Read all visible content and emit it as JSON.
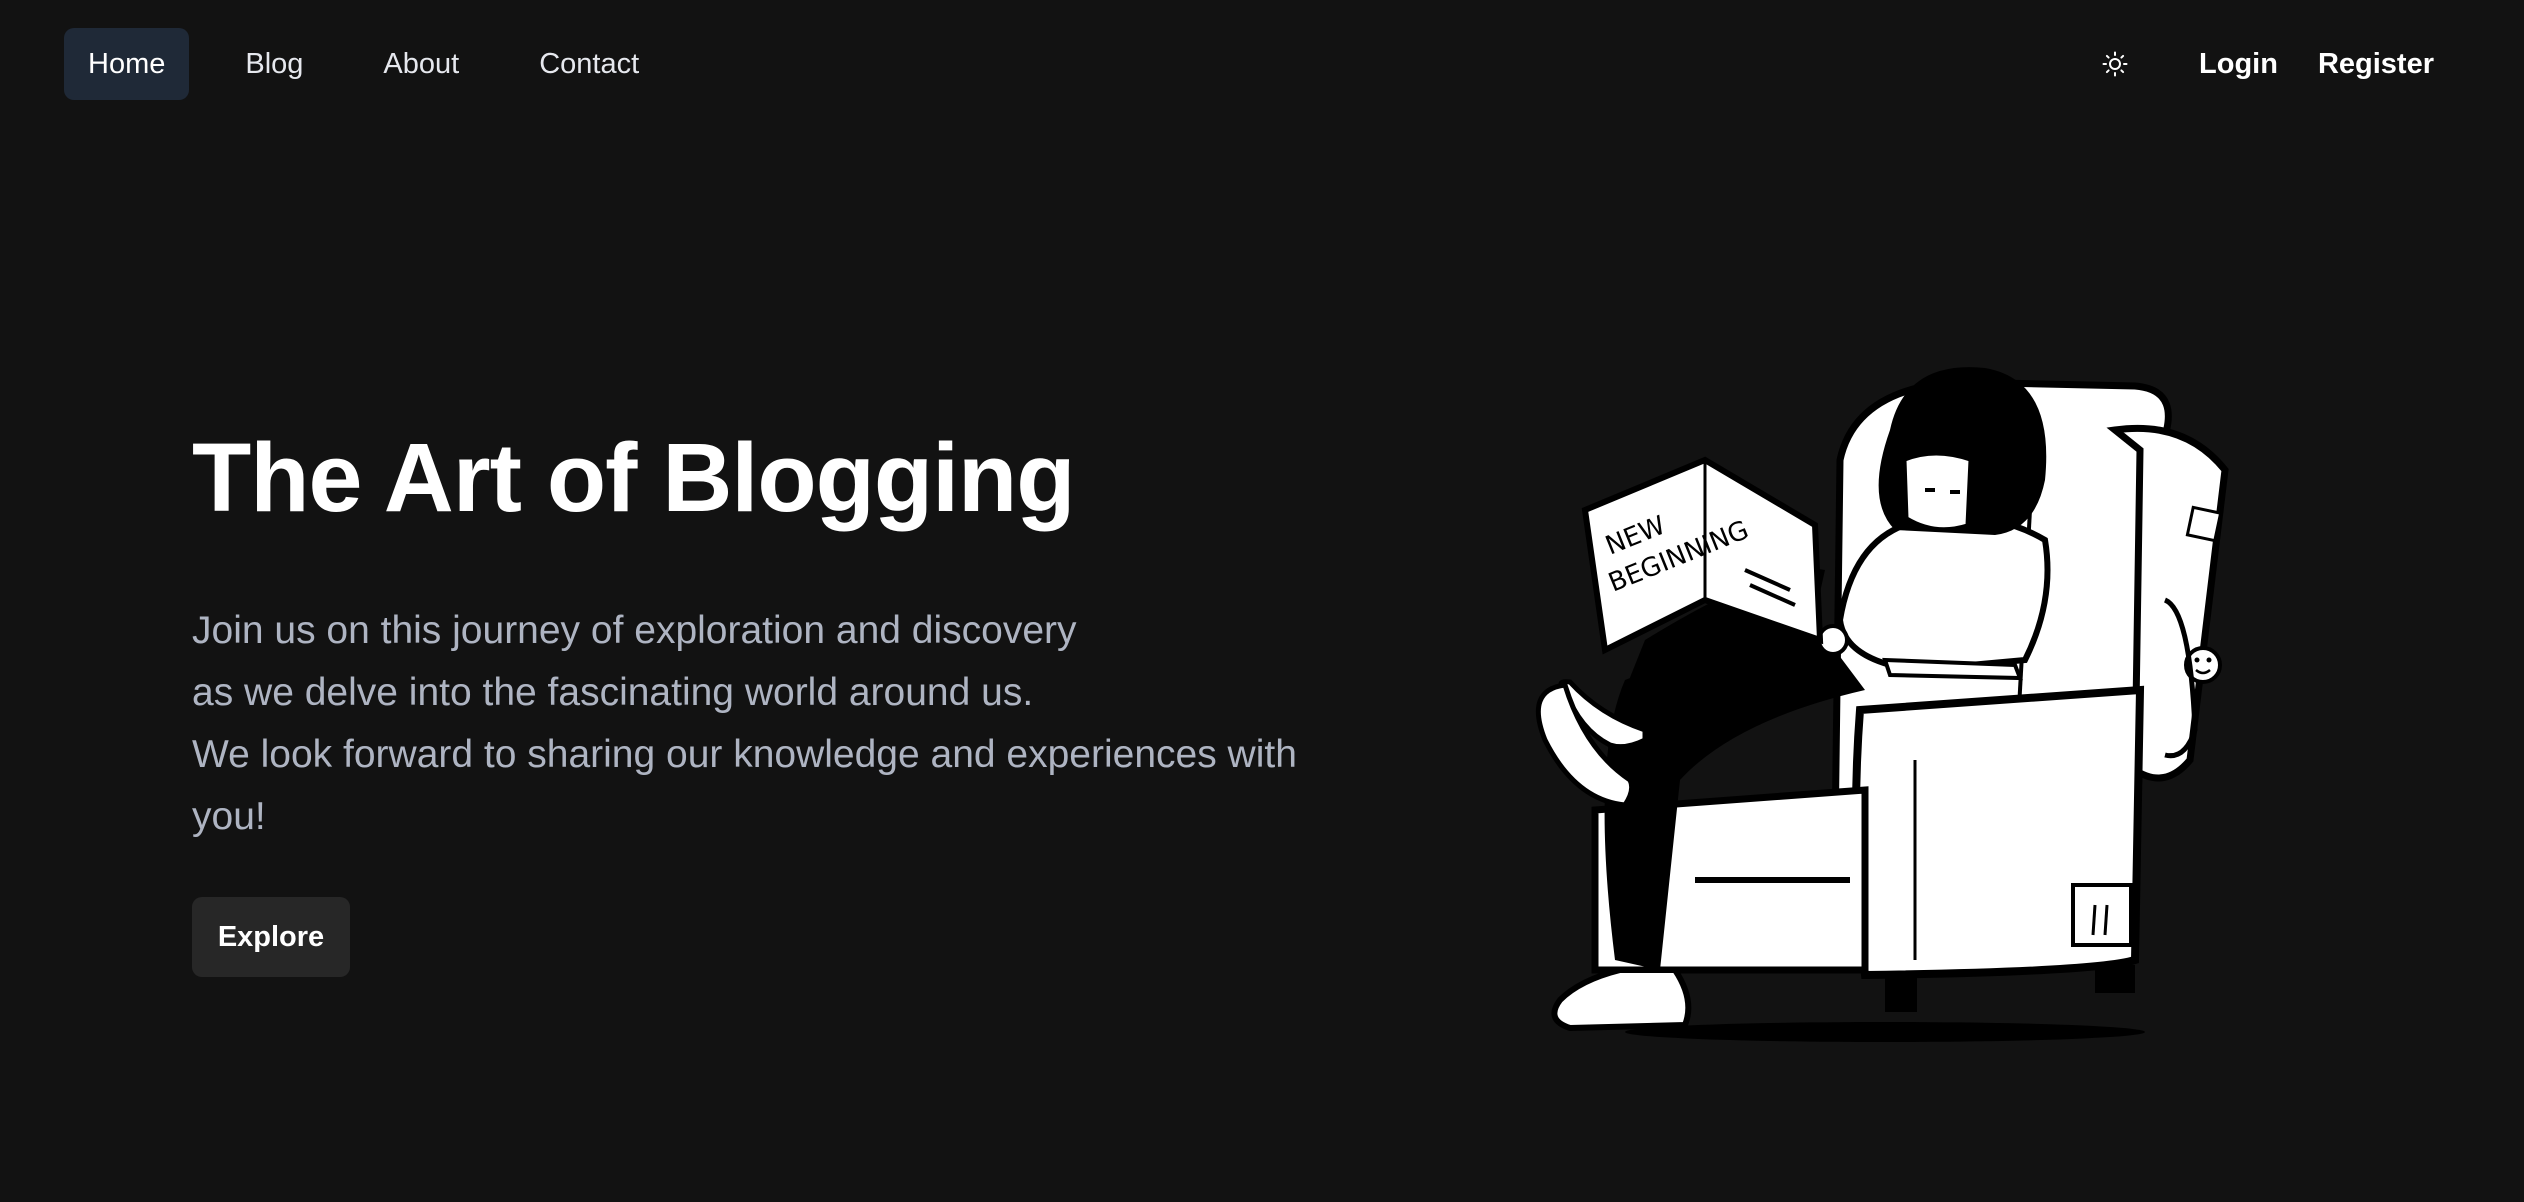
{
  "nav": {
    "items": [
      {
        "label": "Home",
        "active": true
      },
      {
        "label": "Blog",
        "active": false
      },
      {
        "label": "About",
        "active": false
      },
      {
        "label": "Contact",
        "active": false
      }
    ],
    "theme_icon": "sun-icon",
    "login_label": "Login",
    "register_label": "Register"
  },
  "hero": {
    "title": "The Art of Blogging",
    "lines": [
      "Join us on this journey of exploration and discovery",
      "as we delve into the fascinating world around us.",
      "We look forward to sharing our knowledge and experiences with you!"
    ],
    "button_label": "Explore"
  },
  "illustration": {
    "newspaper_text_line1": "NEW",
    "newspaper_text_line2": "BEGINNING"
  },
  "colors": {
    "background": "#121212",
    "active_nav_bg": "#1f2937",
    "body_text": "#aeb4c2",
    "button_bg": "#272727"
  }
}
